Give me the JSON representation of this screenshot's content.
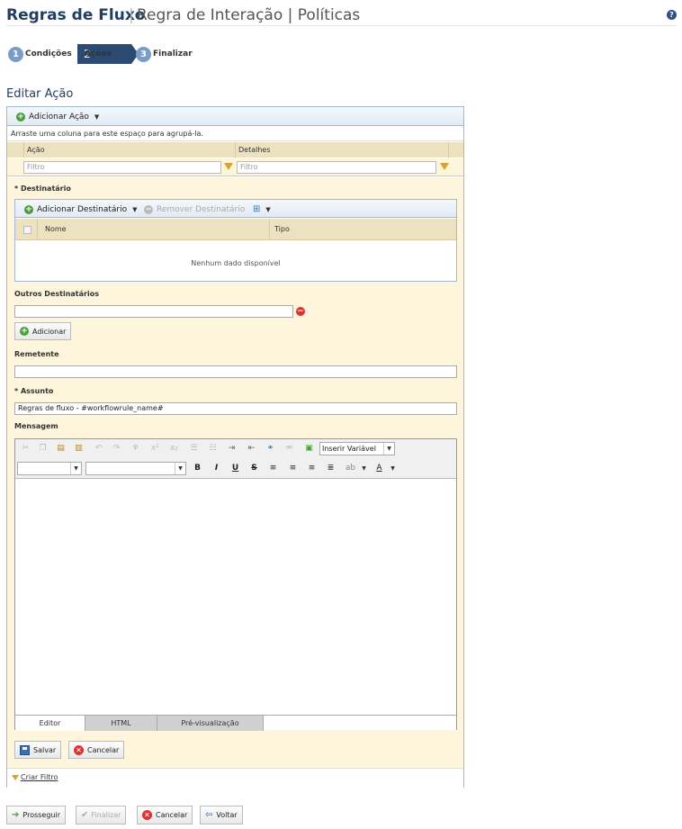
{
  "header": {
    "title": "Regras de Fluxo",
    "separator": "|",
    "subtitle": "Regra de Interação | Políticas",
    "help_icon": "help-icon"
  },
  "wizard": {
    "steps": [
      {
        "num": "1",
        "label": "Condições"
      },
      {
        "num": "2",
        "label": "Ações"
      },
      {
        "num": "3",
        "label": "Finalizar"
      }
    ]
  },
  "section_title": "Editar Ação",
  "toolbar": {
    "add_action": "Adicionar Ação"
  },
  "grid": {
    "group_hint": "Arraste uma coluna para este espaço para agrupá-la.",
    "col_action": "Ação",
    "col_details": "Detalhes",
    "filter_placeholder": "Filtro"
  },
  "recipient": {
    "label": "* Destinatário",
    "add": "Adicionar Destinatário",
    "remove": "Remover Destinatário",
    "col_name": "Nome",
    "col_type": "Tipo",
    "no_data": "Nenhum dado disponível"
  },
  "others": {
    "label": "Outros Destinatários",
    "value": "",
    "add": "Adicionar"
  },
  "sender": {
    "label": "Remetente",
    "value": ""
  },
  "subject": {
    "label": "* Assunto",
    "value": "Regras de fluxo - #workflowrule_name#"
  },
  "message": {
    "label": "Mensagem",
    "insert_variable": "Inserir Variável",
    "tabs": [
      "Editor",
      "HTML",
      "Pré-visualização"
    ]
  },
  "form_buttons": {
    "save": "Salvar",
    "cancel": "Cancelar"
  },
  "footer_link": "Criar Filtro",
  "bottom_buttons": {
    "proceed": "Prosseguir",
    "finish": "Finalizar",
    "cancel": "Cancelar",
    "back": "Voltar"
  }
}
